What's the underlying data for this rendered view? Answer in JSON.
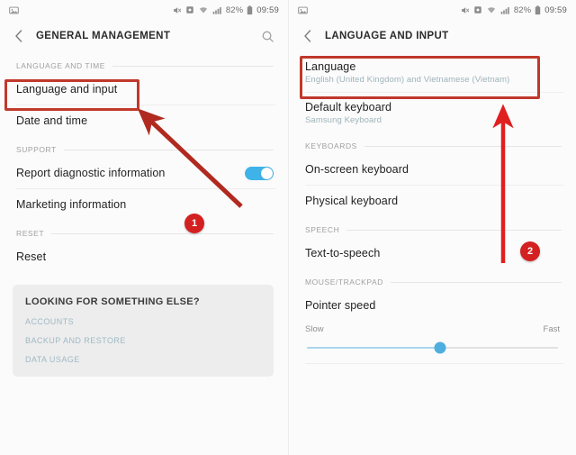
{
  "statusbar": {
    "left_icons": [
      "image-icon"
    ],
    "right_icons": [
      "mute-icon",
      "alarm-icon",
      "wifi-icon",
      "signal-icon",
      "battery-icon"
    ],
    "battery_text": "82%",
    "time": "09:59"
  },
  "left_screen": {
    "appbar": {
      "back_icon": "chevron-left-icon",
      "title": "GENERAL MANAGEMENT",
      "search_icon": "search-icon"
    },
    "sections": [
      {
        "header": "LANGUAGE AND TIME",
        "rows": [
          {
            "title": "Language and input",
            "subtitle": ""
          },
          {
            "title": "Date and time",
            "subtitle": ""
          }
        ]
      },
      {
        "header": "SUPPORT",
        "rows": [
          {
            "title": "Report diagnostic information",
            "subtitle": "",
            "toggle": "on"
          },
          {
            "title": "Marketing information",
            "subtitle": ""
          }
        ]
      },
      {
        "header": "RESET",
        "rows": [
          {
            "title": "Reset",
            "subtitle": ""
          }
        ]
      }
    ],
    "card": {
      "title": "LOOKING FOR SOMETHING ELSE?",
      "links": [
        "ACCOUNTS",
        "BACKUP AND RESTORE",
        "DATA USAGE"
      ]
    }
  },
  "right_screen": {
    "appbar": {
      "back_icon": "chevron-left-icon",
      "title": "LANGUAGE AND INPUT"
    },
    "top_rows": [
      {
        "title": "Language",
        "subtitle": "English (United Kingdom) and Vietnamese (Vietnam)"
      },
      {
        "title": "Default keyboard",
        "subtitle": "Samsung Keyboard"
      }
    ],
    "sections": [
      {
        "header": "KEYBOARDS",
        "rows": [
          {
            "title": "On-screen keyboard",
            "subtitle": ""
          },
          {
            "title": "Physical keyboard",
            "subtitle": ""
          }
        ]
      },
      {
        "header": "SPEECH",
        "rows": [
          {
            "title": "Text-to-speech",
            "subtitle": ""
          }
        ]
      },
      {
        "header": "MOUSE/TRACKPAD",
        "rows": [
          {
            "title": "Pointer speed",
            "subtitle": ""
          }
        ]
      }
    ],
    "slider": {
      "min_label": "Slow",
      "max_label": "Fast",
      "value_percent": 53
    }
  },
  "annotations": {
    "badge_one": "1",
    "badge_two": "2",
    "highlight_color": "#c0392b",
    "arrow_color": "#cc2222"
  }
}
